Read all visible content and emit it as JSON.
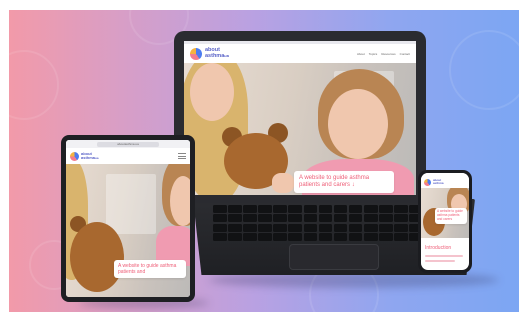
{
  "site": {
    "logo_text_line1": "about",
    "logo_text_line2": "asthma",
    "logo_suffix": "ua",
    "tagline": "A website to guide asthma patients and carers",
    "tagline_arrow": "↓"
  },
  "laptop": {
    "nav": [
      "About",
      "Topics",
      "Resources",
      "Contact"
    ]
  },
  "tablet": {
    "url": "aboutasthma.ua",
    "tagline": "A website to guide asthma patients and"
  },
  "phone": {
    "tagline": "A website to guide asthma patients and carers",
    "section_heading": "Introduction"
  },
  "colors": {
    "brand_pink": "#ee5f78",
    "brand_blue": "#5a63c8",
    "background_left": "#f29aa9",
    "background_right": "#7ca6f3"
  }
}
